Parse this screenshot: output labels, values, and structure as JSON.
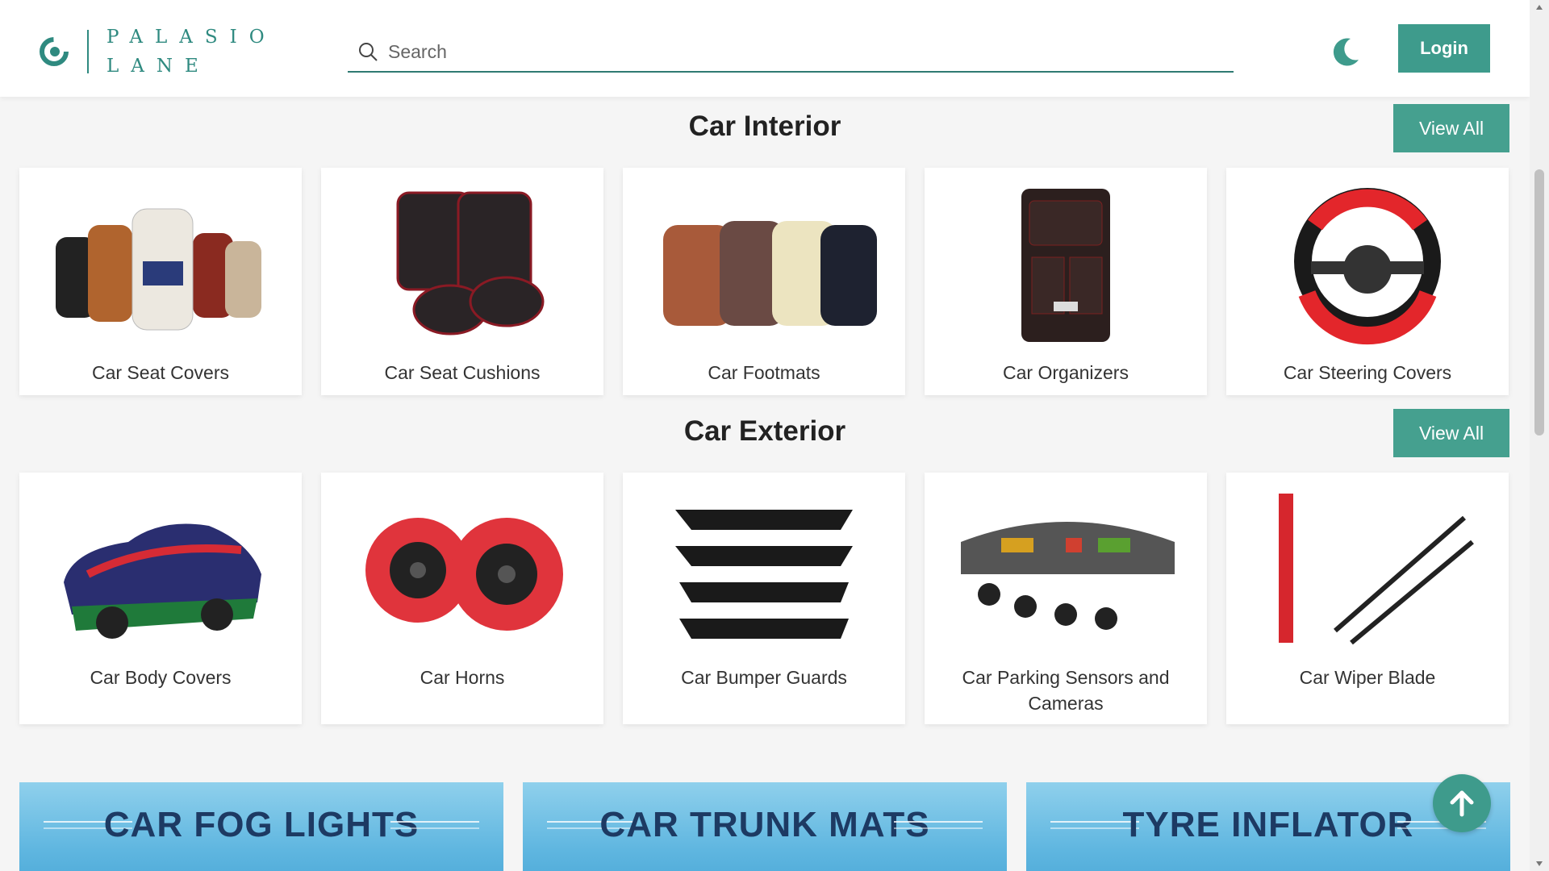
{
  "brand": {
    "line1": "PALASIO",
    "line2": "LANE",
    "accent": "#2f8a80"
  },
  "search": {
    "placeholder": "Search"
  },
  "header": {
    "login_label": "Login",
    "theme_icon": "moon-icon"
  },
  "sections": [
    {
      "title": "Car Interior",
      "view_all": "View All",
      "items": [
        {
          "label": "Car Seat Covers",
          "icon": "car-seat-covers-image"
        },
        {
          "label": "Car Seat Cushions",
          "icon": "car-seat-cushions-image"
        },
        {
          "label": "Car Footmats",
          "icon": "car-footmats-image"
        },
        {
          "label": "Car Organizers",
          "icon": "car-organizers-image"
        },
        {
          "label": "Car Steering Covers",
          "icon": "car-steering-covers-image"
        }
      ]
    },
    {
      "title": "Car Exterior",
      "view_all": "View All",
      "items": [
        {
          "label": "Car Body Covers",
          "icon": "car-body-covers-image"
        },
        {
          "label": "Car Horns",
          "icon": "car-horns-image"
        },
        {
          "label": "Car Bumper Guards",
          "icon": "car-bumper-guards-image"
        },
        {
          "label": "Car Parking Sensors and Cameras",
          "icon": "car-parking-sensors-image"
        },
        {
          "label": "Car Wiper Blade",
          "icon": "car-wiper-blade-image"
        }
      ]
    }
  ],
  "banners": [
    {
      "text": "CAR FOG LIGHTS"
    },
    {
      "text": "CAR TRUNK MATS"
    },
    {
      "text": "TYRE INFLATOR"
    }
  ],
  "colors": {
    "primary_button": "#3e9b8c",
    "view_all": "#45a08f",
    "banner_text": "#1d3a63"
  }
}
